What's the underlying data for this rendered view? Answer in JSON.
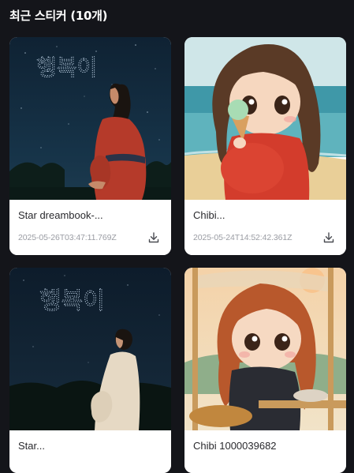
{
  "header": {
    "title": "최근 스티커 (10개)"
  },
  "stickers": [
    {
      "title": "Star dreambook-...",
      "date": "2025-05-26T03:47:11.769Z",
      "sky_text": "행복이"
    },
    {
      "title": "Chibi...",
      "date": "2025-05-24T14:52:42.361Z"
    },
    {
      "title": "Star...",
      "sky_text": "행복이"
    },
    {
      "title": "Chibi 1000039682"
    }
  ],
  "icons": {
    "download": "download-icon"
  },
  "colors": {
    "background": "#14151a",
    "card": "#ffffff",
    "title_text": "#2a2a2e",
    "date_text": "#9a9ca3"
  }
}
